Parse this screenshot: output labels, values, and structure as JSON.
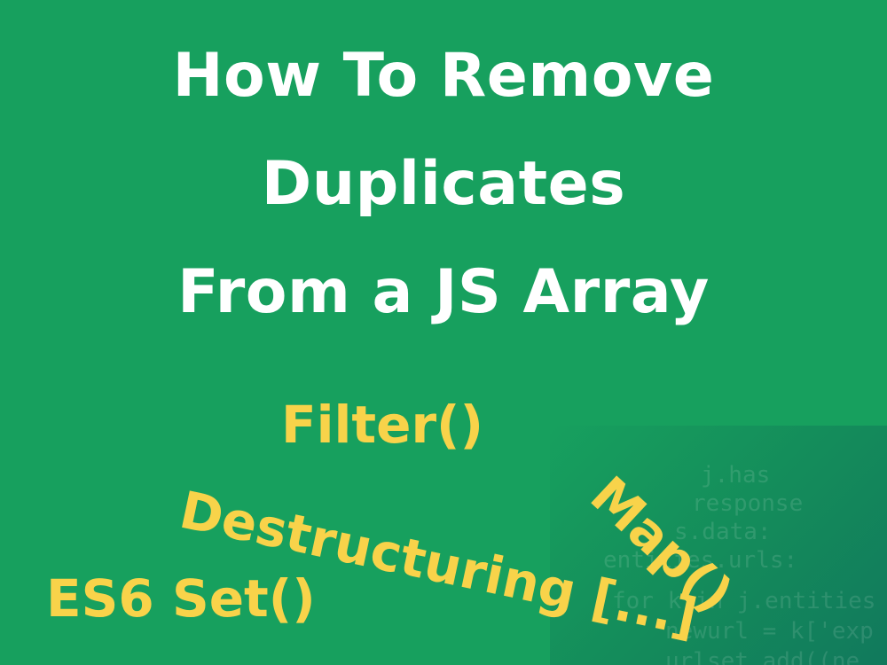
{
  "title": {
    "line1": "How To Remove",
    "line2": "Duplicates",
    "line3": "From a JS Array"
  },
  "labels": {
    "filter": "Filter()",
    "destructuring": "Destructuring [...]",
    "map": "Map()",
    "es6_set": "ES6 Set()"
  },
  "code_lines": [
    "j.has",
    "response",
    "s.data:",
    "entities.urls:",
    "for k in j.entities",
    "newurl = k['exp",
    "urlset.add((ne"
  ],
  "colors": {
    "background": "#17a05e",
    "title": "#ffffff",
    "accent": "#f8d34a"
  }
}
